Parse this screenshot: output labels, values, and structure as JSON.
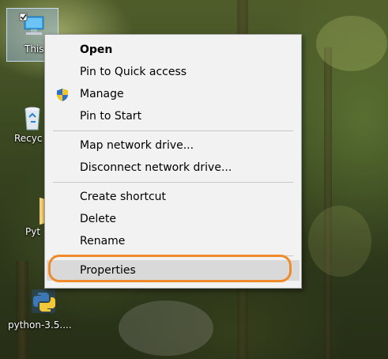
{
  "desktop": {
    "icons": [
      {
        "label": "This",
        "icon": "this-pc-icon"
      },
      {
        "label": "Recyc",
        "icon": "recycle-bin-icon"
      },
      {
        "label": "Pyt",
        "icon": "folder-icon"
      },
      {
        "label": "python-3.5....",
        "icon": "python-installer-icon"
      }
    ]
  },
  "context_menu": {
    "groups": [
      [
        {
          "label": "Open",
          "bold": true
        },
        {
          "label": "Pin to Quick access"
        },
        {
          "label": "Manage",
          "icon": "shield-icon"
        },
        {
          "label": "Pin to Start"
        }
      ],
      [
        {
          "label": "Map network drive..."
        },
        {
          "label": "Disconnect network drive..."
        }
      ],
      [
        {
          "label": "Create shortcut"
        },
        {
          "label": "Delete"
        },
        {
          "label": "Rename"
        }
      ],
      [
        {
          "label": "Properties",
          "highlighted": true
        }
      ]
    ]
  },
  "colors": {
    "highlight_ring": "#f08a2a",
    "menu_background": "#f2f2f2"
  }
}
